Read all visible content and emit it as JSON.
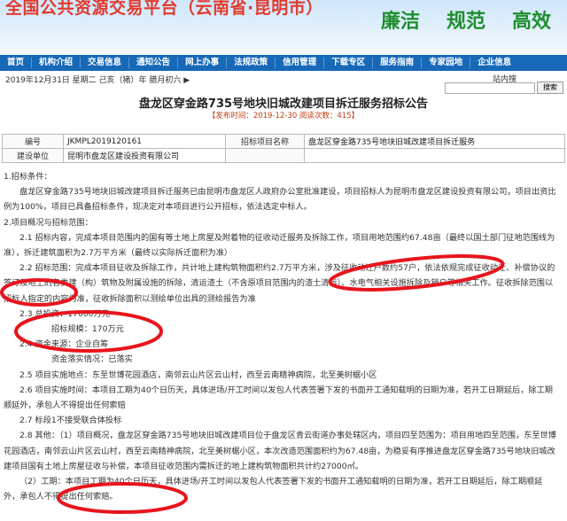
{
  "header": {
    "title": "全国公共资源交易平台（云南省·昆明市）",
    "slogans": [
      "廉洁",
      "规范",
      "高效"
    ]
  },
  "nav": {
    "items": [
      "首页",
      "机构介绍",
      "交易信息",
      "通知公告",
      "网上办事",
      "法规政策",
      "信用管理",
      "下载专区",
      "服务指南",
      "专家园地",
      "企业信息"
    ]
  },
  "infobar": {
    "date": "2019年12月31日 星期二 己亥（猪）年 腊月初六 ▶",
    "station_label": "站内搜",
    "search_button": "搜索"
  },
  "article": {
    "title": "盘龙区穿金路735号地块旧城改建项目拆迁服务招标公告",
    "meta": "【发布时间：2019-12-30  阅读次数：415】"
  },
  "info_table": {
    "rows": [
      [
        "编号",
        "JKMPL2019120161",
        "招标项目名称",
        "盘龙区穿金路735号地块旧城改建项目拆迁服务"
      ],
      [
        "建设单位",
        "昆明市盘龙区建设投资有限公司",
        "",
        ""
      ]
    ]
  },
  "content": {
    "paragraphs": [
      "1.招标条件：",
      "盘龙区穿金路735号地块旧城改建项目拆迁服务已由昆明市盘龙区人政府办公室批准建设，项目招标人为昆明市盘龙区建设投资有限公司，项目出资比例为100%，项目已具备招标条件，现决定对本项目进行公开招标，依法选定中标人。",
      "2.项目概况与招标范围：",
      "2.1 招标内容，完成本项目范围内的国有等土地上房屋及附着物的征收动迁服务及拆除工作，项目用地范围约67.48亩（最终以国土部门征地范围线为准），拆迁建筑面积为2.7万平方米（最终以实际拆迁面积为准）",
      "2.2 招标范围：完成本项目征收及拆除工作，共计地上建构筑物面积约2.7万平方米，涉及征收动迁户数约57户，依法依规完成征收动迁、补偿协议的签订及地上的各类建（构）筑物及附属设施的拆除，清运渣土（不含原项目范围内的渣土清运）、水电气相关设施拆除及销户等相关工作。征收拆除范围以招标人指定的内容为准，征收拆除面积以测绘单位出具的测绘报告为准",
      "2.3 总投资：17000万元",
      "招标规模：170万元",
      "2.4 资金来源：企业自筹",
      "资金落实情况：已落实",
      "2.5 项目实施地点：东至世博花园酒店，南邻云山片区云山村，西至云南精神病院，北至美树椐小区",
      "2.6 项目实施时间：本项目工期为40个日历天，具体进场/开工时间以发包人代表签署下发的书面开工通知载明的日期为准，若开工日期延后，除工期顺延外，承包人不得提出任何索赔",
      "2.7 标段1不接受联合体投标",
      "2.8 其他：（1）项目概况，盘龙区穿金路735号地块旧城改建项目位于盘龙区青云街道办事处辖区内，项目四至范围为：项目用地四至范围，东至世博花园酒店，南邻云山片区云山村，西至云南精神病院，北至美树椐小区，本次改造范围面积约为67.48亩，为稳妥有序推进盘龙区穿金路735号地块旧城改建项目国有土地上房屋征收与补偿，本项目征收范围内需拆迁的地上建构筑物面积共计约27000㎡。",
      "（2）工期：本项目工期为40个日历天，具体进场/开工时间以发包人代表签署下发的书面开工通知载明的日期为准，若开工日期延后，除工期顺延外，承包人不得提出任何索赔。"
    ]
  },
  "annotations": {
    "color": "#e8141c"
  }
}
